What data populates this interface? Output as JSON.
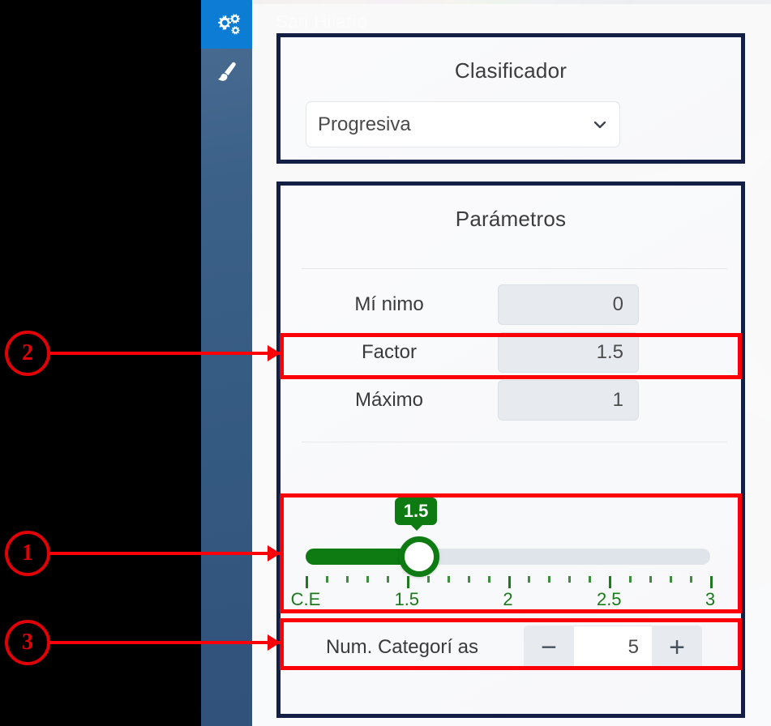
{
  "sidebar": {
    "items": [
      {
        "name": "settings",
        "icon": "gears-icon",
        "active": true
      },
      {
        "name": "style",
        "icon": "paint-brush-icon",
        "active": false
      }
    ]
  },
  "watermark_text": "San Hilario",
  "classifier_panel": {
    "title": "Clasificador",
    "select": {
      "value": "Progresiva",
      "icon": "chevron-down-icon",
      "options": [
        "Progresiva"
      ]
    }
  },
  "parameters_panel": {
    "title": "Parámetros",
    "rows": [
      {
        "label": "Mí nimo",
        "value": "0"
      },
      {
        "label": "Factor",
        "value": "1.5"
      },
      {
        "label": "Máximo",
        "value": "1"
      }
    ],
    "slider": {
      "tooltip_value": "1.5",
      "value": 1.5,
      "min_label": "C.E",
      "fill_percent": 28,
      "accent_color": "#0d7a12",
      "track_color": "#dfe4ea",
      "tick_labels": [
        "C.E",
        "1.5",
        "2",
        "2.5",
        "3"
      ],
      "tick_label_positions": [
        0,
        28,
        56,
        78,
        100
      ],
      "major_tick_count": 5,
      "minor_ticks_between": 4
    },
    "stepper": {
      "label": "Num. Categorí as",
      "value": "5",
      "decrement_label": "−",
      "increment_label": "+"
    }
  },
  "annotations": {
    "color": "#fb0007",
    "callouts": [
      {
        "id": "1",
        "label": "1",
        "target": "slider"
      },
      {
        "id": "2",
        "label": "2",
        "target": "factor-row"
      },
      {
        "id": "3",
        "label": "3",
        "target": "num-categorias-row"
      }
    ]
  }
}
